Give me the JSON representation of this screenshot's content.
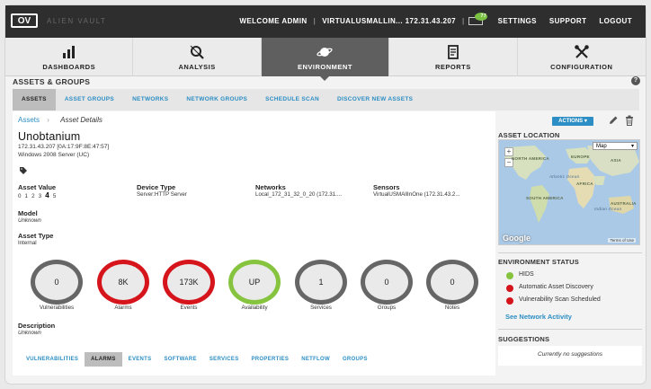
{
  "topbar": {
    "logo": "OV",
    "brand": "ALIEN VAULT",
    "welcome": "WELCOME ADMIN",
    "host": "VIRTUALUSMALLIN... 172.31.43.207",
    "mail_count": "77",
    "settings": "SETTINGS",
    "support": "SUPPORT",
    "logout": "LOGOUT"
  },
  "nav": [
    {
      "label": "DASHBOARDS",
      "icon": "bar-chart-icon"
    },
    {
      "label": "ANALYSIS",
      "icon": "magnifier-icon"
    },
    {
      "label": "ENVIRONMENT",
      "icon": "planet-icon"
    },
    {
      "label": "REPORTS",
      "icon": "report-icon"
    },
    {
      "label": "CONFIGURATION",
      "icon": "tools-icon"
    }
  ],
  "section_title": "ASSETS & GROUPS",
  "subtabs": [
    "ASSETS",
    "ASSET GROUPS",
    "NETWORKS",
    "NETWORK GROUPS",
    "SCHEDULE SCAN",
    "DISCOVER NEW ASSETS"
  ],
  "breadcrumb": {
    "root": "Assets",
    "current": "Asset Details"
  },
  "actions_label": "ACTIONS ▾",
  "asset": {
    "name": "Unobtanium",
    "ip_mac": "172.31.43.207 [0A:17:9F:8E:47:57]",
    "os": "Windows 2008 Server (UC)",
    "fields": {
      "asset_value_label": "Asset Value",
      "rating_pre": "0 1 2 3 ",
      "rating_selected": "4",
      "rating_post": " 5",
      "device_type_label": "Device Type",
      "device_type_value": "Server:HTTP Server",
      "networks_label": "Networks",
      "networks_value": "Local_172_31_32_0_20 (172.31....",
      "sensors_label": "Sensors",
      "sensors_value": "VirtualUSMAllInOne (172.31.43.2...",
      "model_label": "Model",
      "model_value": "Unknown",
      "asset_type_label": "Asset Type",
      "asset_type_value": "Internal",
      "description_label": "Description",
      "description_value": "Unknown"
    },
    "stats": [
      {
        "value": "0",
        "label": "Vulnerabilities",
        "state": "neutral"
      },
      {
        "value": "8K",
        "label": "Alarms",
        "state": "red"
      },
      {
        "value": "173K",
        "label": "Events",
        "state": "red"
      },
      {
        "value": "UP",
        "label": "Availability",
        "state": "green"
      },
      {
        "value": "1",
        "label": "Services",
        "state": "neutral"
      },
      {
        "value": "0",
        "label": "Groups",
        "state": "neutral"
      },
      {
        "value": "0",
        "label": "Notes",
        "state": "neutral"
      }
    ]
  },
  "bottom_tabs": [
    "VULNERABILITIES",
    "ALARMS",
    "EVENTS",
    "SOFTWARE",
    "SERVICES",
    "PROPERTIES",
    "NETFLOW",
    "GROUPS"
  ],
  "side": {
    "location_title": "ASSET LOCATION",
    "map_type": "Map",
    "map_labels": {
      "north_america": "NORTH AMERICA",
      "europe": "EUROPE",
      "asia": "ASIA",
      "africa": "AFRICA",
      "south_america": "SOUTH AMERICA",
      "australia": "AUSTRALIA",
      "atlantic": "Atlantic Ocean",
      "indian": "Indian Ocean"
    },
    "google": "Google",
    "terms": "Terms of Use",
    "env_title": "ENVIRONMENT STATUS",
    "env_items": [
      {
        "label": "HIDS",
        "color": "#86c440"
      },
      {
        "label": "Automatic Asset Discovery",
        "color": "#d6141b"
      },
      {
        "label": "Vulnerability Scan Scheduled",
        "color": "#d6141b"
      }
    ],
    "env_link": "See Network Activity",
    "sugg_title": "SUGGESTIONS",
    "sugg_text": "Currently no suggestions"
  }
}
